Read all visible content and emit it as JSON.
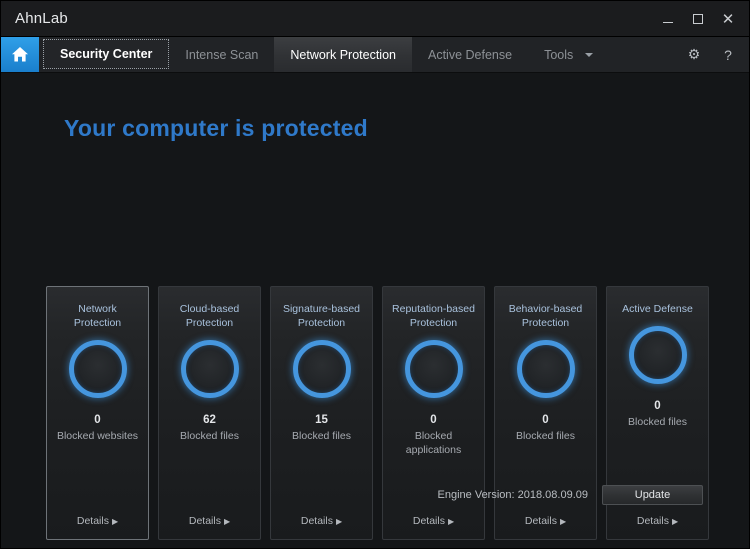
{
  "window": {
    "app_title": "AhnLab",
    "controls": {
      "minimize": "minimize-icon",
      "maximize": "maximize-icon",
      "close": "✕"
    }
  },
  "navbar": {
    "home_icon": "home-icon",
    "tabs": [
      {
        "label": "Security Center",
        "state": "selected"
      },
      {
        "label": "Intense Scan",
        "state": "normal"
      },
      {
        "label": "Network Protection",
        "state": "hover"
      },
      {
        "label": "Active Defense",
        "state": "normal"
      },
      {
        "label": "Tools",
        "state": "normal",
        "has_caret": true
      }
    ],
    "settings_icon": "⚙",
    "help_icon": "?"
  },
  "main": {
    "headline": "Your computer is protected",
    "headline_color": "#2f79c9",
    "accent_color": "#4596de",
    "cards": [
      {
        "title": "Network\nProtection",
        "title_line1": "Network",
        "title_line2": "Protection",
        "count": "0",
        "count_label": "Blocked websites",
        "details": "Details",
        "selected": true
      },
      {
        "title_line1": "Cloud-based",
        "title_line2": "Protection",
        "count": "62",
        "count_label": "Blocked files",
        "details": "Details",
        "selected": false
      },
      {
        "title_line1": "Signature-based",
        "title_line2": "Protection",
        "count": "15",
        "count_label": "Blocked files",
        "details": "Details",
        "selected": false
      },
      {
        "title_line1": "Reputation-based",
        "title_line2": "Protection",
        "count": "0",
        "count_label": "Blocked applications",
        "details": "Details",
        "selected": false
      },
      {
        "title_line1": "Behavior-based",
        "title_line2": "Protection",
        "count": "0",
        "count_label": "Blocked files",
        "details": "Details",
        "selected": false
      },
      {
        "title_line1": "Active Defense",
        "title_line2": "",
        "count": "0",
        "count_label": "Blocked files",
        "details": "Details",
        "selected": false
      }
    ]
  },
  "footer": {
    "engine_version": "Engine Version: 2018.08.09.09",
    "update_label": "Update"
  }
}
